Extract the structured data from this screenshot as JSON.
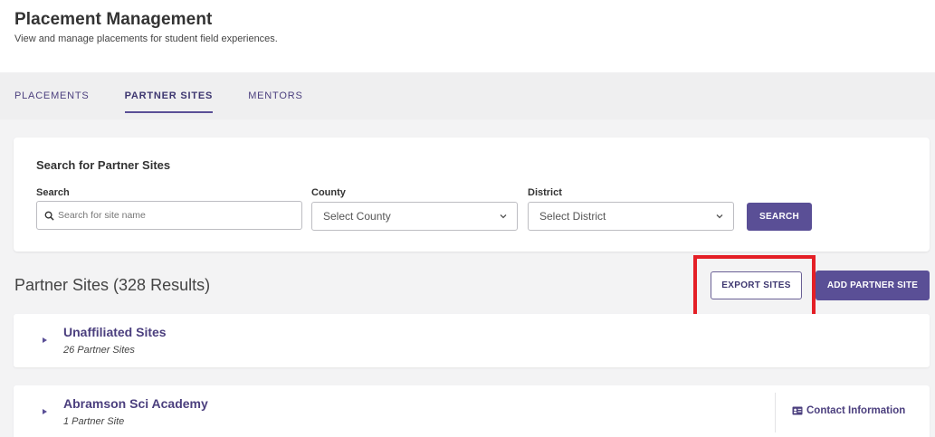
{
  "header": {
    "title": "Placement Management",
    "subtitle": "View and manage placements for student field experiences."
  },
  "tabs": [
    {
      "label": "PLACEMENTS",
      "active": false
    },
    {
      "label": "PARTNER SITES",
      "active": true
    },
    {
      "label": "MENTORS",
      "active": false
    }
  ],
  "search_card": {
    "title": "Search for Partner Sites",
    "search": {
      "label": "Search",
      "placeholder": "Search for site name",
      "icon": "search-icon"
    },
    "county": {
      "label": "County",
      "selected": "Select County"
    },
    "district": {
      "label": "District",
      "selected": "Select District"
    },
    "search_button": "SEARCH"
  },
  "results": {
    "title": "Partner Sites (328 Results)",
    "export_button": "EXPORT SITES",
    "add_button": "ADD PARTNER SITE",
    "rows": [
      {
        "name": "Unaffiliated Sites",
        "count": "26 Partner Sites"
      },
      {
        "name": "Abramson Sci Academy",
        "count": "1 Partner Site",
        "contact": "Contact Information"
      }
    ]
  },
  "colors": {
    "accent": "#5a4f96",
    "highlight": "#e41f26"
  }
}
